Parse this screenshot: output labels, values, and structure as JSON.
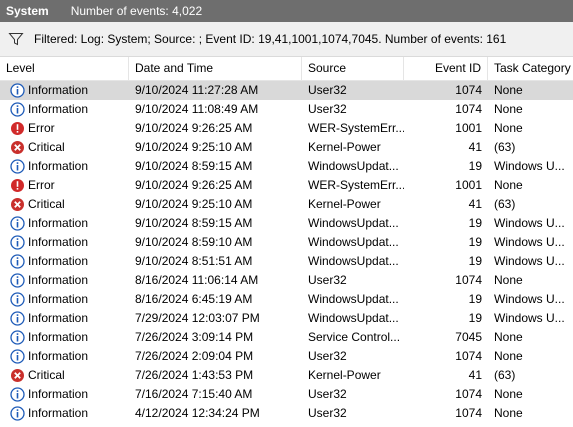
{
  "title_bar": {
    "log_name": "System",
    "event_count": "Number of events: 4,022"
  },
  "filter_bar": {
    "icon": "filter-icon",
    "text": "Filtered: Log: System; Source: ; Event ID: 19,41,1001,1074,7045. Number of events: 161"
  },
  "columns": {
    "level": "Level",
    "date_time": "Date and Time",
    "source": "Source",
    "event_id": "Event ID",
    "task_category": "Task Category"
  },
  "level_colors": {
    "Information": "#1e5bb8",
    "Error": "#d12a2a",
    "Critical": "#c9302c"
  },
  "rows": [
    {
      "level": "Information",
      "icon": "information-icon",
      "date": "9/10/2024 11:27:28 AM",
      "source": "User32",
      "event_id": "1074",
      "task": "None",
      "selected": true
    },
    {
      "level": "Information",
      "icon": "information-icon",
      "date": "9/10/2024 11:08:49 AM",
      "source": "User32",
      "event_id": "1074",
      "task": "None"
    },
    {
      "level": "Error",
      "icon": "error-icon",
      "date": "9/10/2024 9:26:25 AM",
      "source": "WER-SystemErr...",
      "event_id": "1001",
      "task": "None"
    },
    {
      "level": "Critical",
      "icon": "critical-icon",
      "date": "9/10/2024 9:25:10 AM",
      "source": "Kernel-Power",
      "event_id": "41",
      "task": "(63)"
    },
    {
      "level": "Information",
      "icon": "information-icon",
      "date": "9/10/2024 8:59:15 AM",
      "source": "WindowsUpdat...",
      "event_id": "19",
      "task": "Windows U..."
    },
    {
      "level": "Error",
      "icon": "error-icon",
      "date": "9/10/2024 9:26:25 AM",
      "source": "WER-SystemErr...",
      "event_id": "1001",
      "task": "None"
    },
    {
      "level": "Critical",
      "icon": "critical-icon",
      "date": "9/10/2024 9:25:10 AM",
      "source": "Kernel-Power",
      "event_id": "41",
      "task": "(63)"
    },
    {
      "level": "Information",
      "icon": "information-icon",
      "date": "9/10/2024 8:59:15 AM",
      "source": "WindowsUpdat...",
      "event_id": "19",
      "task": "Windows U..."
    },
    {
      "level": "Information",
      "icon": "information-icon",
      "date": "9/10/2024 8:59:10 AM",
      "source": "WindowsUpdat...",
      "event_id": "19",
      "task": "Windows U..."
    },
    {
      "level": "Information",
      "icon": "information-icon",
      "date": "9/10/2024 8:51:51 AM",
      "source": "WindowsUpdat...",
      "event_id": "19",
      "task": "Windows U..."
    },
    {
      "level": "Information",
      "icon": "information-icon",
      "date": "8/16/2024 11:06:14 AM",
      "source": "User32",
      "event_id": "1074",
      "task": "None"
    },
    {
      "level": "Information",
      "icon": "information-icon",
      "date": "8/16/2024 6:45:19 AM",
      "source": "WindowsUpdat...",
      "event_id": "19",
      "task": "Windows U..."
    },
    {
      "level": "Information",
      "icon": "information-icon",
      "date": "7/29/2024 12:03:07 PM",
      "source": "WindowsUpdat...",
      "event_id": "19",
      "task": "Windows U..."
    },
    {
      "level": "Information",
      "icon": "information-icon",
      "date": "7/26/2024 3:09:14 PM",
      "source": "Service Control...",
      "event_id": "7045",
      "task": "None"
    },
    {
      "level": "Information",
      "icon": "information-icon",
      "date": "7/26/2024 2:09:04 PM",
      "source": "User32",
      "event_id": "1074",
      "task": "None"
    },
    {
      "level": "Critical",
      "icon": "critical-icon",
      "date": "7/26/2024 1:43:53 PM",
      "source": "Kernel-Power",
      "event_id": "41",
      "task": "(63)"
    },
    {
      "level": "Information",
      "icon": "information-icon",
      "date": "7/16/2024 7:15:40 AM",
      "source": "User32",
      "event_id": "1074",
      "task": "None"
    },
    {
      "level": "Information",
      "icon": "information-icon",
      "date": "4/12/2024 12:34:24 PM",
      "source": "User32",
      "event_id": "1074",
      "task": "None"
    }
  ]
}
